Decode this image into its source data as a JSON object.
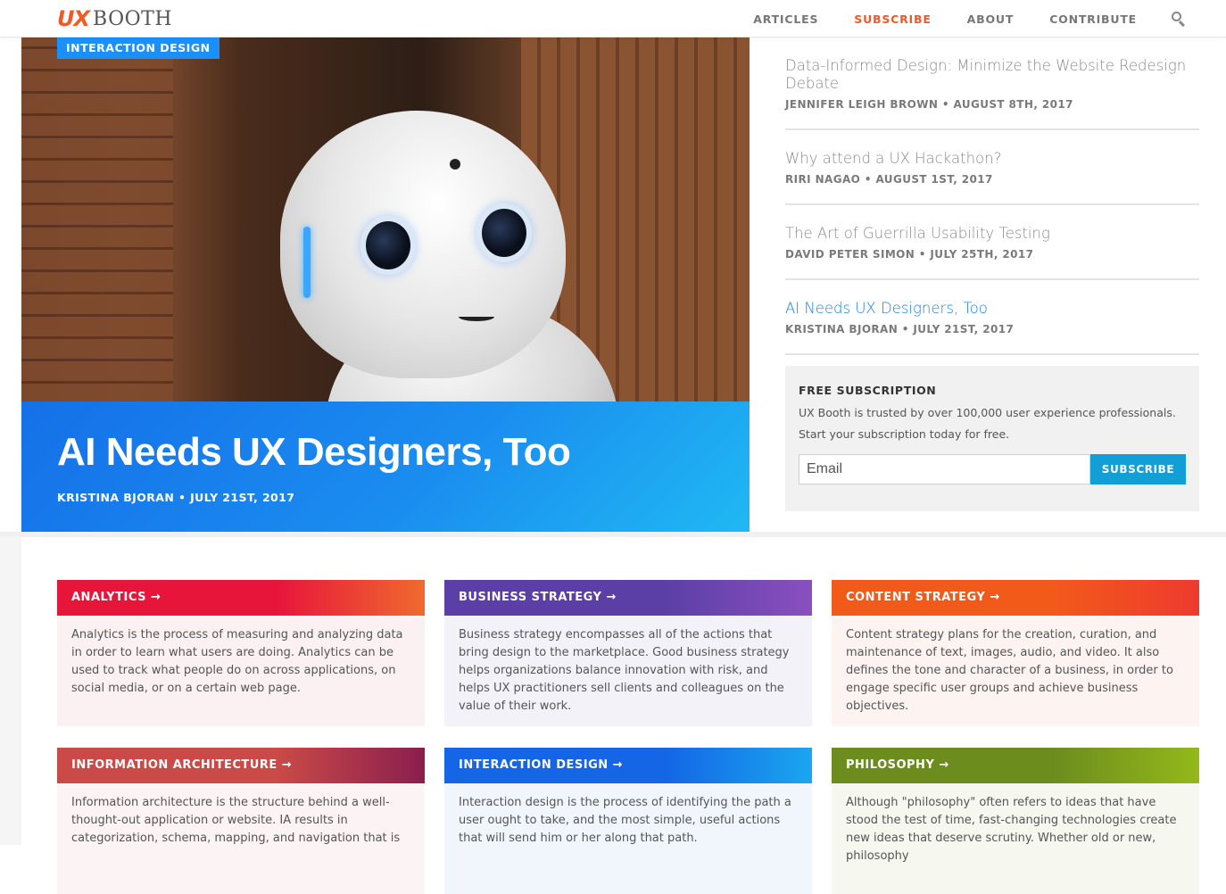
{
  "header": {
    "logo_ux": "UX",
    "logo_booth": "BOOTH",
    "nav": [
      "ARTICLES",
      "SUBSCRIBE",
      "ABOUT",
      "CONTRIBUTE"
    ],
    "active_nav": "SUBSCRIBE",
    "accent_color": "#f15a24"
  },
  "hero": {
    "category": "INTERACTION DESIGN",
    "title": "AI Needs UX Designers, Too",
    "meta": "KRISTINA BJORAN • JULY 21ST, 2017"
  },
  "sidebar": {
    "posts": [
      {
        "title": "Data-Informed Design: Minimize the Website Redesign Debate",
        "meta": "JENNIFER LEIGH BROWN • AUGUST 8TH, 2017"
      },
      {
        "title": "Why attend a UX Hackathon?",
        "meta": "RIRI NAGAO • AUGUST 1ST, 2017"
      },
      {
        "title": "The Art of Guerrilla Usability Testing",
        "meta": "DAVID PETER SIMON • JULY 25TH, 2017"
      },
      {
        "title": "AI Needs UX Designers, Too",
        "meta": "KRISTINA BJORAN • JULY 21ST, 2017"
      }
    ],
    "subscription": {
      "heading": "FREE SUBSCRIPTION",
      "text": "UX Booth is trusted by over 100,000 user experience professionals. Start your subscription today for free.",
      "email_placeholder": "Email",
      "button": "SUBSCRIBE"
    }
  },
  "categories": [
    {
      "label": "ANALYTICS →",
      "color_from": "#e8153b",
      "color_to": "#ef6a2e",
      "body": "Analytics is the process of measuring and analyzing data in order to learn what users are doing. Analytics can be used to track what people do on across applications, on social media, or on a certain web page."
    },
    {
      "label": "BUSINESS STRATEGY →",
      "color_from": "#5b3fa7",
      "color_to": "#8a4fc0",
      "body": "Business strategy encompasses all of the actions that bring design to the marketplace. Good business strategy helps organizations balance innovation with risk, and helps UX practitioners sell clients and colleagues on the value of their work."
    },
    {
      "label": "CONTENT STRATEGY →",
      "color_from": "#f25a1a",
      "color_to": "#ee3a2f",
      "body": "Content strategy plans for the creation, curation, and maintenance of text, images, audio, and video. It also defines the tone and character of a business, in order to engage specific user groups and achieve business objectives."
    },
    {
      "label": "INFORMATION ARCHITECTURE →",
      "color_from": "#c94a47",
      "color_to": "#8a1e4e",
      "body": "Information architecture is the structure behind a well-thought-out application or website. IA results in categorization, schema, mapping, and navigation that is"
    },
    {
      "label": "INTERACTION DESIGN →",
      "color_from": "#1466e6",
      "color_to": "#1aa6f0",
      "body": "Interaction design is the process of identifying the path a user ought to take, and the most simple, useful actions that will send him or her along that path."
    },
    {
      "label": "PHILOSOPHY →",
      "color_from": "#6c8c1e",
      "color_to": "#93b81a",
      "body": "Although \"philosophy\" often refers to ideas that have stood the test of time, fast-changing technologies create new ideas that deserve scrutiny. Whether old or new, philosophy"
    }
  ]
}
